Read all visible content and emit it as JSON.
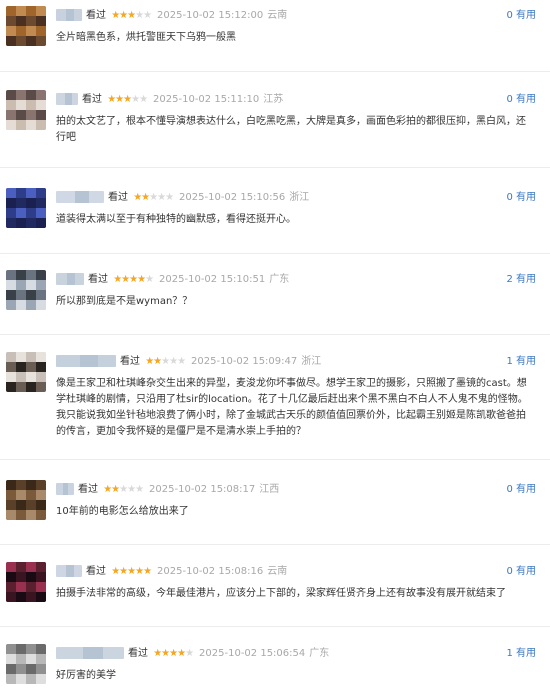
{
  "comments": [
    {
      "watched": "看过",
      "rating": 3,
      "time": "2025-10-02 15:12:00",
      "location": "云南",
      "useful": "0 有用",
      "content": "全片暗黑色系，烘托警匪天下乌鸦一般黑",
      "avatar_colors": [
        "#a0652a",
        "#4a3020",
        "#c08a50",
        "#6b4a30"
      ],
      "name_color": "#c7d2de"
    },
    {
      "watched": "看过",
      "rating": 3,
      "time": "2025-10-02 15:11:10",
      "location": "江苏",
      "useful": "0 有用",
      "content": "拍的太文艺了，根本不懂导演想表达什么，白吃黑吃黑，大牌是真多，画面色彩拍的都很压抑，黑白风，还行吧",
      "avatar_colors": [
        "#cbbcb0",
        "#5a4a48",
        "#e6dcd6",
        "#8a7470"
      ],
      "name_color": "#cdd6e0"
    },
    {
      "watched": "看过",
      "rating": 2,
      "time": "2025-10-02 15:10:56",
      "location": "浙江",
      "useful": "0 有用",
      "content": "道装得太满以至于有种独特的幽默感，看得还挺开心。",
      "avatar_colors": [
        "#2d3d8a",
        "#1a2050",
        "#4a5fc0",
        "#202a60"
      ],
      "name_color": "#cfd8e4"
    },
    {
      "watched": "看过",
      "rating": 4,
      "time": "2025-10-02 15:10:51",
      "location": "广东",
      "useful": "2 有用",
      "content": "所以那到底是不是wyman？？",
      "avatar_colors": [
        "#9aa6b4",
        "#3a4048",
        "#d6dce2",
        "#6a7480"
      ],
      "name_color": "#c9d3de"
    },
    {
      "watched": "看过",
      "rating": 2,
      "time": "2025-10-02 15:09:47",
      "location": "浙江",
      "useful": "1 有用",
      "content": "像是王家卫和杜琪峰杂交生出来的异型，麦浚龙你坏事做尽。想学王家卫的摄影，只照搬了墨镜的cast。想学杜琪峰的剧情，只沿用了杜sir的location。花了十几亿最后赶出来个黑不黑白不白人不人鬼不鬼的怪物。我只能说我如坐针毡地浪费了俩小时，除了金城武古天乐的颜值值回票价外，比起霸王别姬是陈凯歌爸爸拍的传言，更加令我怀疑的是僵尸是不是清水崇上手拍的？",
      "avatar_colors": [
        "#c8c0b8",
        "#2a2420",
        "#e8e2dc",
        "#6a5e54"
      ],
      "name_color": "#c4d0dc"
    },
    {
      "watched": "看过",
      "rating": 2,
      "time": "2025-10-02 15:08:17",
      "location": "江西",
      "useful": "0 有用",
      "content": "10年前的电影怎么给放出来了",
      "avatar_colors": [
        "#7a5a3a",
        "#3a2818",
        "#a88a6a",
        "#5a4028"
      ],
      "name_color": "#cad4e0"
    },
    {
      "watched": "看过",
      "rating": 5,
      "time": "2025-10-02 15:08:16",
      "location": "云南",
      "useful": "0 有用",
      "content": "拍摄手法非常的高级，今年最佳港片，应该分上下部的，梁家辉任贤齐身上还有故事没有展开就结束了",
      "avatar_colors": [
        "#5a2030",
        "#1a0a14",
        "#9a3050",
        "#3a1420"
      ],
      "name_color": "#cdd6e2"
    },
    {
      "watched": "看过",
      "rating": 4,
      "time": "2025-10-02 15:06:54",
      "location": "广东",
      "useful": "1 有用",
      "content": "好厉害的美学",
      "avatar_colors": [
        "#b8b8b8",
        "#6a6a6a",
        "#dedede",
        "#909090"
      ],
      "name_color": "#cbd5e0"
    }
  ]
}
